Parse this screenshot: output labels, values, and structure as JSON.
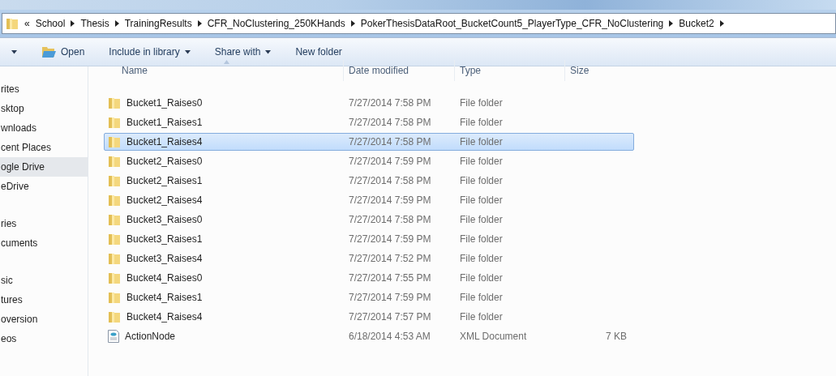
{
  "address_bar": {
    "overflow": "«",
    "crumbs": [
      "School",
      "Thesis",
      "TrainingResults",
      "CFR_NoClustering_250KHands",
      "PokerThesisDataRoot_BucketCount5_PlayerType_CFR_NoClustering",
      "Bucket2"
    ]
  },
  "toolbar": {
    "buttons": [
      {
        "kind": "menu-caret"
      },
      {
        "kind": "open",
        "label": "Open"
      },
      {
        "kind": "dropdown",
        "label": "Include in library"
      },
      {
        "kind": "dropdown",
        "label": "Share with"
      },
      {
        "kind": "plain",
        "label": "New folder"
      }
    ]
  },
  "sidebar": {
    "groups": [
      {
        "items": [
          {
            "label": "rites",
            "selected": false
          },
          {
            "label": "sktop",
            "selected": false
          },
          {
            "label": "wnloads",
            "selected": false
          },
          {
            "label": "cent Places",
            "selected": false
          },
          {
            "label": "ogle Drive",
            "selected": true
          },
          {
            "label": "eDrive",
            "selected": false
          }
        ]
      },
      {
        "items": [
          {
            "label": "ries",
            "selected": false
          },
          {
            "label": "cuments",
            "selected": false
          }
        ]
      },
      {
        "items": [
          {
            "label": "sic",
            "selected": false
          },
          {
            "label": "tures",
            "selected": false
          },
          {
            "label": "oversion",
            "selected": false
          },
          {
            "label": "eos",
            "selected": false
          }
        ]
      }
    ]
  },
  "table": {
    "columns": [
      {
        "label": "Name",
        "sorted": true
      },
      {
        "label": "Date modified",
        "sorted": false
      },
      {
        "label": "Type",
        "sorted": false
      },
      {
        "label": "Size",
        "sorted": false
      }
    ],
    "rows": [
      {
        "kind": "folder",
        "name": "Bucket1_Raises0",
        "date": "7/27/2014 7:58 PM",
        "type": "File folder",
        "selected": false
      },
      {
        "kind": "folder",
        "name": "Bucket1_Raises1",
        "date": "7/27/2014 7:58 PM",
        "type": "File folder",
        "selected": false
      },
      {
        "kind": "folder",
        "name": "Bucket1_Raises4",
        "date": "7/27/2014 7:58 PM",
        "type": "File folder",
        "selected": true
      },
      {
        "kind": "folder",
        "name": "Bucket2_Raises0",
        "date": "7/27/2014 7:59 PM",
        "type": "File folder",
        "selected": false
      },
      {
        "kind": "folder",
        "name": "Bucket2_Raises1",
        "date": "7/27/2014 7:58 PM",
        "type": "File folder",
        "selected": false
      },
      {
        "kind": "folder",
        "name": "Bucket2_Raises4",
        "date": "7/27/2014 7:59 PM",
        "type": "File folder",
        "selected": false
      },
      {
        "kind": "folder",
        "name": "Bucket3_Raises0",
        "date": "7/27/2014 7:58 PM",
        "type": "File folder",
        "selected": false
      },
      {
        "kind": "folder",
        "name": "Bucket3_Raises1",
        "date": "7/27/2014 7:59 PM",
        "type": "File folder",
        "selected": false
      },
      {
        "kind": "folder",
        "name": "Bucket3_Raises4",
        "date": "7/27/2014 7:52 PM",
        "type": "File folder",
        "selected": false
      },
      {
        "kind": "folder",
        "name": "Bucket4_Raises0",
        "date": "7/27/2014 7:55 PM",
        "type": "File folder",
        "selected": false
      },
      {
        "kind": "folder",
        "name": "Bucket4_Raises1",
        "date": "7/27/2014 7:59 PM",
        "type": "File folder",
        "selected": false
      },
      {
        "kind": "folder",
        "name": "Bucket4_Raises4",
        "date": "7/27/2014 7:57 PM",
        "type": "File folder",
        "selected": false
      },
      {
        "kind": "xml",
        "name": "ActionNode",
        "date": "6/18/2014 4:53 AM",
        "type": "XML Document",
        "size": "7 KB",
        "selected": false
      }
    ]
  }
}
